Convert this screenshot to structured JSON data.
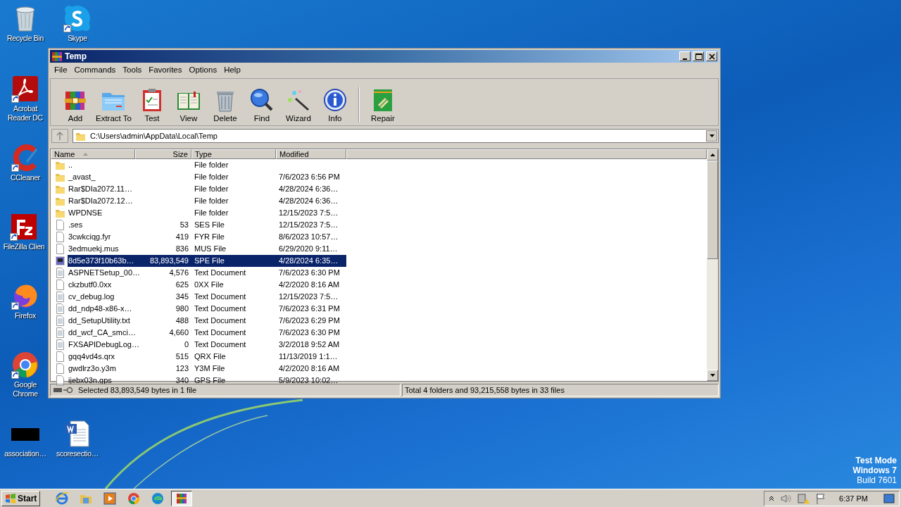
{
  "desktop_icons": [
    {
      "label": "Recycle Bin",
      "kind": "trash",
      "shortcut": false
    },
    {
      "label": "Skype",
      "kind": "chat",
      "shortcut": true
    },
    {
      "label": "Acrobat Reader DC",
      "kind": "pdf",
      "shortcut": true
    },
    {
      "label": "CCleaner",
      "kind": "cleaner",
      "shortcut": true
    },
    {
      "label": "FileZilla Clien",
      "kind": "ftp",
      "shortcut": true
    },
    {
      "label": "Firefox",
      "kind": "fox",
      "shortcut": true
    },
    {
      "label": "Google Chrome",
      "kind": "chrome",
      "shortcut": true
    },
    {
      "label": "association…",
      "kind": "blank",
      "shortcut": false
    },
    {
      "label": "scoresectio…",
      "kind": "doc",
      "shortcut": false
    }
  ],
  "desktop_text": [
    "Test Mode",
    "Windows 7",
    "Build 7601"
  ],
  "window": {
    "title": "Temp",
    "menu": [
      "File",
      "Commands",
      "Tools",
      "Favorites",
      "Options",
      "Help"
    ],
    "toolbar": [
      {
        "label": "Add",
        "kind": "add"
      },
      {
        "label": "Extract To",
        "kind": "extract"
      },
      {
        "label": "Test",
        "kind": "test"
      },
      {
        "label": "View",
        "kind": "view"
      },
      {
        "label": "Delete",
        "kind": "delete"
      },
      {
        "label": "Find",
        "kind": "find"
      },
      {
        "label": "Wizard",
        "kind": "wizard"
      },
      {
        "label": "Info",
        "kind": "info"
      },
      {
        "label": "Repair",
        "kind": "repair"
      }
    ],
    "address": "C:\\Users\\admin\\AppData\\Local\\Temp",
    "columns": [
      {
        "label": "Name",
        "sorted": true
      },
      {
        "label": "Size",
        "sorted": false
      },
      {
        "label": "Type",
        "sorted": false
      },
      {
        "label": "Modified",
        "sorted": false
      }
    ],
    "rows": [
      {
        "kind": "folder",
        "name": "..",
        "size": "",
        "type": "File folder",
        "modified": "",
        "selected": false
      },
      {
        "kind": "folder",
        "name": "_avast_",
        "size": "",
        "type": "File folder",
        "modified": "7/6/2023 6:56 PM",
        "selected": false
      },
      {
        "kind": "folder",
        "name": "Rar$DIa2072.11…",
        "size": "",
        "type": "File folder",
        "modified": "4/28/2024 6:36…",
        "selected": false
      },
      {
        "kind": "folder",
        "name": "Rar$DIa2072.12…",
        "size": "",
        "type": "File folder",
        "modified": "4/28/2024 6:36…",
        "selected": false
      },
      {
        "kind": "folder",
        "name": "WPDNSE",
        "size": "",
        "type": "File folder",
        "modified": "12/15/2023 7:5…",
        "selected": false
      },
      {
        "kind": "file",
        "name": ".ses",
        "size": "53",
        "type": "SES File",
        "modified": "12/15/2023 7:5…",
        "selected": false
      },
      {
        "kind": "file",
        "name": "3cwkciqg.fyr",
        "size": "419",
        "type": "FYR File",
        "modified": "8/6/2023 10:57…",
        "selected": false
      },
      {
        "kind": "file",
        "name": "3edmuekj.mus",
        "size": "836",
        "type": "MUS File",
        "modified": "6/29/2020 9:11…",
        "selected": false
      },
      {
        "kind": "app",
        "name": "8d5e373f10b63b…",
        "size": "83,893,549",
        "type": "SPE File",
        "modified": "4/28/2024 6:35…",
        "selected": true
      },
      {
        "kind": "text",
        "name": "ASPNETSetup_00…",
        "size": "4,576",
        "type": "Text Document",
        "modified": "7/6/2023 6:30 PM",
        "selected": false
      },
      {
        "kind": "file",
        "name": "ckzbutf0.0xx",
        "size": "625",
        "type": "0XX File",
        "modified": "4/2/2020 8:16 AM",
        "selected": false
      },
      {
        "kind": "text",
        "name": "cv_debug.log",
        "size": "345",
        "type": "Text Document",
        "modified": "12/15/2023 7:5…",
        "selected": false
      },
      {
        "kind": "text",
        "name": "dd_ndp48-x86-x…",
        "size": "980",
        "type": "Text Document",
        "modified": "7/6/2023 6:31 PM",
        "selected": false
      },
      {
        "kind": "text",
        "name": "dd_SetupUtility.txt",
        "size": "488",
        "type": "Text Document",
        "modified": "7/6/2023 6:29 PM",
        "selected": false
      },
      {
        "kind": "text",
        "name": "dd_wcf_CA_smci…",
        "size": "4,660",
        "type": "Text Document",
        "modified": "7/6/2023 6:30 PM",
        "selected": false
      },
      {
        "kind": "text",
        "name": "FXSAPIDebugLog…",
        "size": "0",
        "type": "Text Document",
        "modified": "3/2/2018 9:52 AM",
        "selected": false
      },
      {
        "kind": "file",
        "name": "gqq4vd4s.qrx",
        "size": "515",
        "type": "QRX File",
        "modified": "11/13/2019 1:1…",
        "selected": false
      },
      {
        "kind": "file",
        "name": "gwdlrz3o.y3m",
        "size": "123",
        "type": "Y3M File",
        "modified": "4/2/2020 8:16 AM",
        "selected": false
      },
      {
        "kind": "file",
        "name": "ijebx03n.gps",
        "size": "340",
        "type": "GPS File",
        "modified": "5/9/2023 10:02…",
        "selected": false
      }
    ],
    "status_left": "Selected 83,893,549 bytes in 1 file",
    "status_right": "Total 4 folders and 93,215,558 bytes in 33 files"
  },
  "taskbar": {
    "start": "Start",
    "apps": [
      {
        "kind": "ie",
        "active": false
      },
      {
        "kind": "explorer",
        "active": false
      },
      {
        "kind": "media",
        "active": false
      },
      {
        "kind": "chrome",
        "active": false
      },
      {
        "kind": "edge",
        "active": false
      },
      {
        "kind": "rar",
        "active": true
      }
    ],
    "clock": "6:37 PM"
  }
}
